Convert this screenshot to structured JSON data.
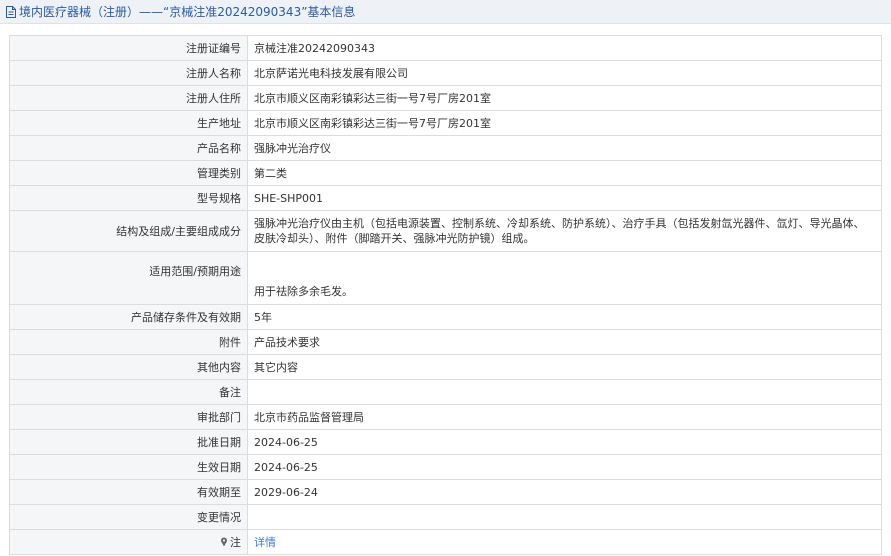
{
  "header": {
    "title": "境内医疗器械（注册）——“京械注准20242090343”基本信息",
    "icon": "document-icon"
  },
  "rows": [
    {
      "label": "注册证编号",
      "value": "京械注准20242090343"
    },
    {
      "label": "注册人名称",
      "value": "北京萨诺光电科技发展有限公司"
    },
    {
      "label": "注册人住所",
      "value": "北京市顺义区南彩镇彩达三街一号7号厂房201室"
    },
    {
      "label": "生产地址",
      "value": "北京市顺义区南彩镇彩达三街一号7号厂房201室"
    },
    {
      "label": "产品名称",
      "value": "强脉冲光治疗仪"
    },
    {
      "label": "管理类别",
      "value": "第二类"
    },
    {
      "label": "型号规格",
      "value": "SHE-SHP001"
    },
    {
      "label": "结构及组成/主要组成成分",
      "value": "强脉冲光治疗仪由主机（包括电源装置、控制系统、冷却系统、防护系统）、治疗手具（包括发射氙光器件、氙灯、导光晶体、皮肤冷却头）、附件（脚踏开关、强脉冲光防护镜）组成。"
    },
    {
      "label": "适用范围/预期用途",
      "value": "用于祛除多余毛发。"
    },
    {
      "label": "产品储存条件及有效期",
      "value": "5年"
    },
    {
      "label": "附件",
      "value": "产品技术要求"
    },
    {
      "label": "其他内容",
      "value": "其它内容"
    },
    {
      "label": "备注",
      "value": ""
    },
    {
      "label": "审批部门",
      "value": "北京市药品监督管理局"
    },
    {
      "label": "批准日期",
      "value": "2024-06-25"
    },
    {
      "label": "生效日期",
      "value": "2024-06-25"
    },
    {
      "label": "有效期至",
      "value": "2029-06-24"
    },
    {
      "label": "变更情况",
      "value": ""
    }
  ],
  "note": {
    "label": "注",
    "icon": "pin-icon",
    "link_text": "详情"
  },
  "colors": {
    "title_text": "#2a5aa6",
    "title_bg": "#eef1f5",
    "label_bg": "#f5f6f8",
    "border": "#dcdcdc",
    "link": "#3a7bd5"
  }
}
